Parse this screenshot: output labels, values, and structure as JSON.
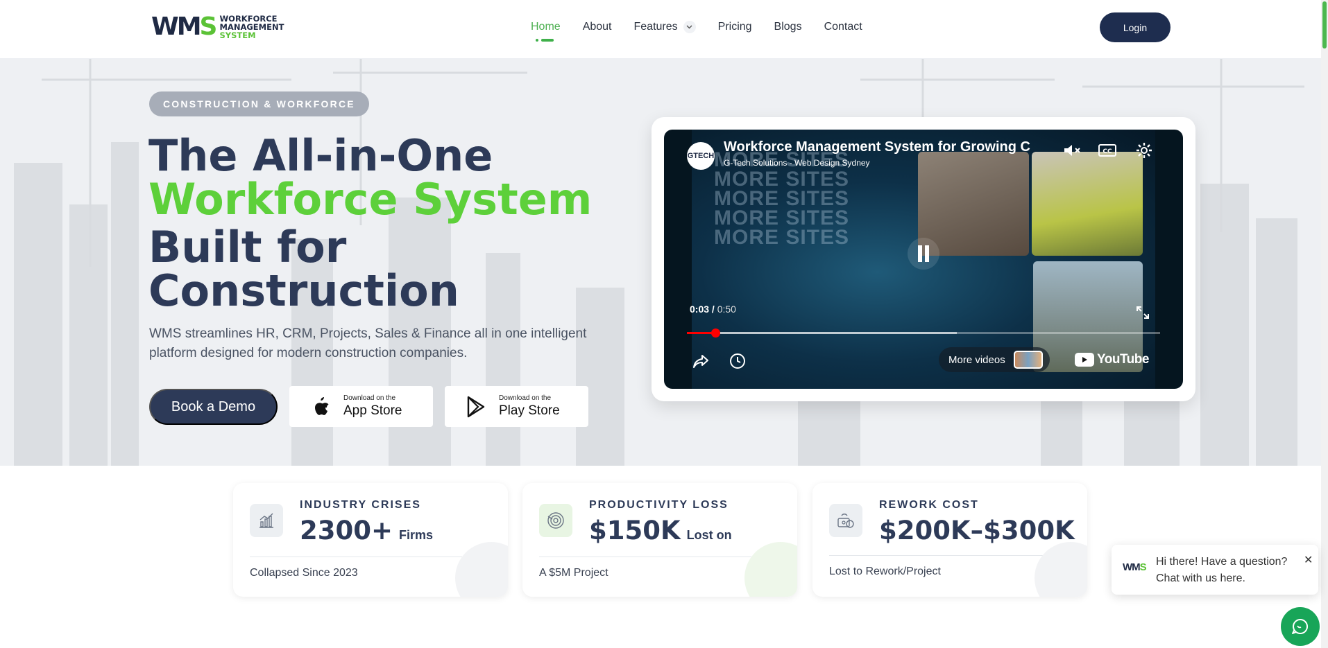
{
  "header": {
    "logo": {
      "mark_a": "WM",
      "mark_b": "S",
      "line1": "WORKFORCE",
      "line2": "MANAGEMENT",
      "line3": "SYSTEM"
    },
    "nav": [
      {
        "label": "Home",
        "active": true
      },
      {
        "label": "About"
      },
      {
        "label": "Features",
        "has_dropdown": true
      },
      {
        "label": "Pricing"
      },
      {
        "label": "Blogs"
      },
      {
        "label": "Contact"
      }
    ],
    "login_label": "Login"
  },
  "hero": {
    "badge": "CONSTRUCTION & WORKFORCE",
    "headline_1": "The All-in-One",
    "headline_2": "Workforce System",
    "headline_3": "Built for",
    "headline_4": "Construction",
    "subtitle": "WMS streamlines HR, CRM, Projects, Sales & Finance all in one intelligent platform designed for modern construction companies.",
    "demo_label": "Book a Demo",
    "app_store": {
      "small": "Download on the",
      "big": "App Store"
    },
    "play_store": {
      "small": "Download on the",
      "big": "Play Store"
    }
  },
  "video": {
    "title": "Workforce Management System for Growing C",
    "channel": "G-Tech Solutions - Web Design Sydney",
    "avatar_text": "GTECH",
    "overlay_words": [
      "MORE SITES",
      "MORE SITES",
      "MORE SITES",
      "MORE SITES",
      "MORE SITES"
    ],
    "current_time": "0:03",
    "duration": "0:50",
    "played_fraction": 0.06,
    "buffered_fraction": 0.57,
    "more_videos_label": "More videos",
    "youtube_label": "YouTube"
  },
  "stats": [
    {
      "icon": "bar-chart-icon",
      "label": "INDUSTRY CRISES",
      "value": "2300+",
      "unit": "Firms",
      "foot": "Collapsed Since 2023",
      "icon_bg": "#eceff2"
    },
    {
      "icon": "spiral-icon",
      "label": "PRODUCTIVITY LOSS",
      "value": "$150K",
      "unit": "Lost on",
      "foot": "A $5M Project",
      "icon_bg": "#e8f5e3"
    },
    {
      "icon": "money-icon",
      "label": "REWORK COST",
      "value": "$200K–$300K",
      "unit": "",
      "foot": "Lost to Rework/Project",
      "icon_bg": "#eceff2"
    }
  ],
  "chat": {
    "logo_a": "WM",
    "logo_b": "S",
    "message": "Hi there! Have a question? Chat with us here.",
    "close": "✕"
  },
  "colors": {
    "navy": "#2d3a58",
    "green": "#5dd03a",
    "nav_active": "#4caf50",
    "chat_fab": "#18a558"
  }
}
